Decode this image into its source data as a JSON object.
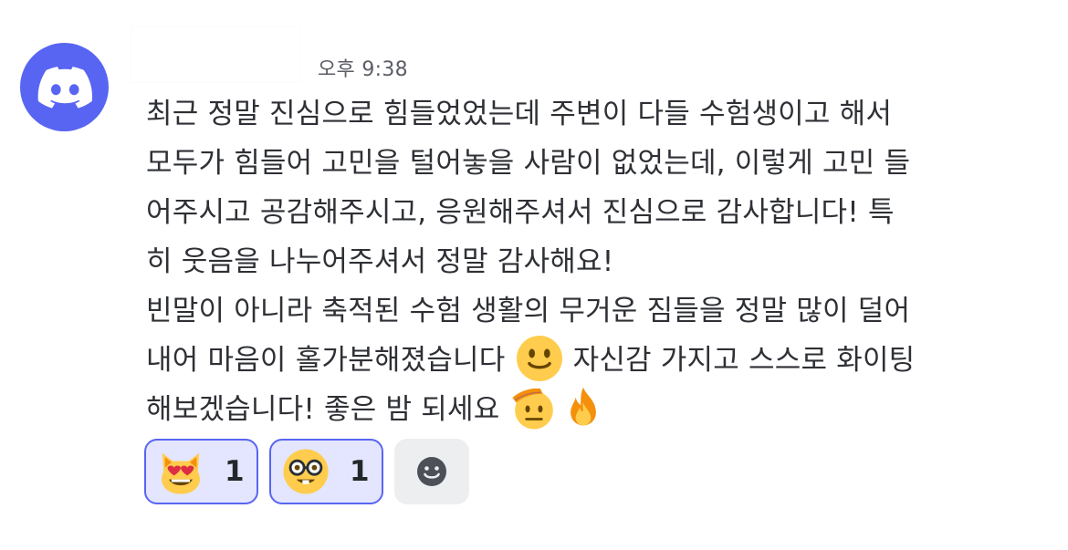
{
  "message": {
    "timestamp": "오후 9:38",
    "lines": [
      {
        "text": "최근 정말 진심으로 힘들었었는데 주변이 다들 수험생이고 해서"
      },
      {
        "text": "모두가 힘들어 고민을 털어놓을 사람이 없었는데, 이렇게 고민 들"
      },
      {
        "text": "어주시고 공감해주시고, 응원해주셔서 진심으로 감사합니다! 특"
      },
      {
        "text": "히 웃음을 나누어주셔서 정말 감사해요!"
      },
      {
        "text": "빈말이 아니라 축적된 수험 생활의 무거운 짐들을 정말 많이 덜어"
      },
      {
        "text_before": "내어 마음이 홀가분해졌습니다 ",
        "text_after": " 자신감 가지고 스스로 화이팅"
      },
      {
        "text": "해보겠습니다! 좋은 밤 되세요"
      }
    ],
    "inline_emojis": [
      "slightly-smiling-face",
      "saluting-face",
      "fire"
    ]
  },
  "reactions": [
    {
      "emoji": "smiling-cat-with-heart-eyes",
      "count": "1"
    },
    {
      "emoji": "nerd-face",
      "count": "1"
    }
  ],
  "add_reaction_icon": "add-reaction-smiley-icon",
  "colors": {
    "brand": "#5865f2",
    "reaction_bg": "#e3e6fe",
    "add_reaction_bg": "#eceef0",
    "text": "#2e3035",
    "timestamp": "#5c5e66",
    "emoji_yellow": "#ffcc4d"
  }
}
